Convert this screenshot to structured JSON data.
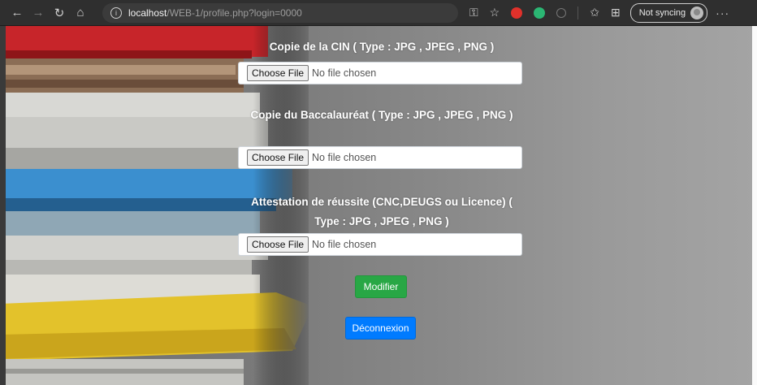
{
  "browser": {
    "url_host": "localhost",
    "url_path": "/WEB-1/profile.php?login=0000",
    "sync_label": "Not syncing",
    "back_icon": "←",
    "forward_icon": "→",
    "refresh_icon": "↻",
    "home_icon": "⌂",
    "info_icon": "i",
    "key_icon": "⚿",
    "star_icon": "☆",
    "favorites_icon": "✩",
    "collections_icon": "⊞",
    "more_icon": "···"
  },
  "form": {
    "cin_label": "Copie de la CIN ( Type : JPG , JPEG , PNG )",
    "bac_label": "Copie du Baccalauréat ( Type : JPG , JPEG , PNG )",
    "attestation_label": "Attestation de réussite (CNC,DEUGS ou Licence) ( Type : JPG , JPEG , PNG )",
    "choose_file": "Choose File",
    "no_file": "No file chosen"
  },
  "buttons": {
    "modifier": "Modifier",
    "logout": "Déconnexion"
  },
  "colors": {
    "success": "#28a745",
    "primary": "#007bff"
  }
}
